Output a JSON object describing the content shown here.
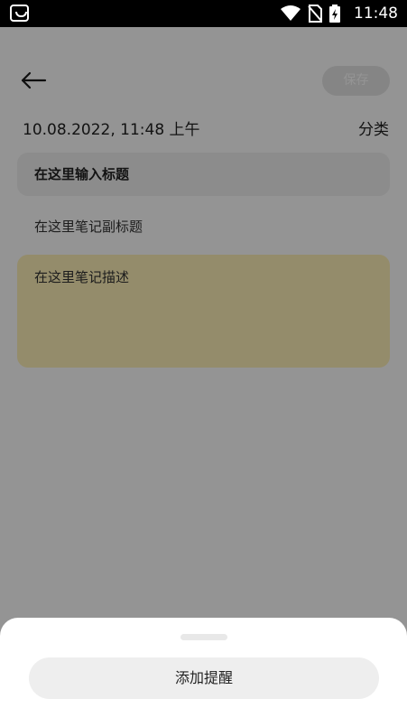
{
  "status_bar": {
    "time": "11:48",
    "icons": [
      "wifi-icon",
      "no-sim-icon",
      "battery-charging-icon"
    ]
  },
  "header": {
    "back_icon": "arrow-left-icon",
    "save_label": "保存"
  },
  "meta": {
    "datetime": "10.08.2022, 11:48 上午",
    "category_label": "分类"
  },
  "note": {
    "title_placeholder": "在这里输入标题",
    "subtitle_placeholder": "在这里笔记副标题",
    "description_placeholder": "在这里笔记描述"
  },
  "color_palette": {
    "colors": [
      "#f5dc8a",
      "#f5b9a0",
      "#f3a3b4",
      "#d7b8ec",
      "#b9b8f0",
      "#9fe0c0",
      "#a6d6f2"
    ],
    "selected_color": "#fff2b8"
  },
  "bottom_sheet": {
    "reminder_button_label": "添加提醒"
  }
}
